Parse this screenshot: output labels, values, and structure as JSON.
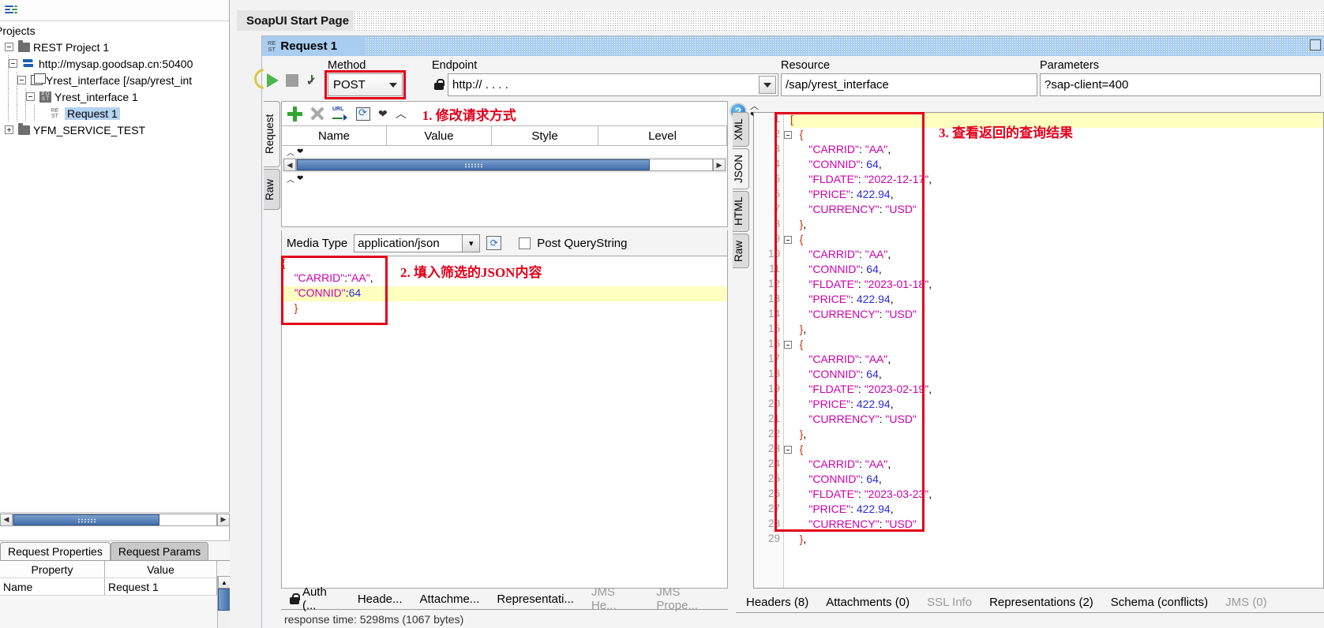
{
  "navigator": {
    "toolbar_icon": "list-green-blue-icon",
    "root_label": "Projects",
    "tree": [
      {
        "label": "REST Project 1",
        "icon": "folder-icon",
        "depth": 0,
        "expander": "minus",
        "selected": false
      },
      {
        "label": "http://mysap.goodsap.cn:50400",
        "icon": "endpoint-arrows-icon",
        "depth": 1,
        "expander": "minus",
        "selected": false
      },
      {
        "label": "Yrest_interface [/sap/yrest_int",
        "icon": "resource-window-icon",
        "depth": 2,
        "expander": "minus",
        "selected": false
      },
      {
        "label": "Yrest_interface 1",
        "icon": "post-method-icon",
        "depth": 3,
        "expander": "minus",
        "selected": false
      },
      {
        "label": "Request 1",
        "icon": "rest-request-icon",
        "depth": 4,
        "expander": "none",
        "selected": true
      },
      {
        "label": "YFM_SERVICE_TEST",
        "icon": "folder-icon",
        "depth": 0,
        "expander": "plus",
        "selected": false
      }
    ],
    "bottom_tabs": [
      {
        "label": "Request Properties",
        "active": true
      },
      {
        "label": "Request Params",
        "active": false
      }
    ],
    "properties_table": {
      "headers": [
        "Property",
        "Value"
      ],
      "rows": [
        [
          "Name",
          "Request 1"
        ]
      ]
    }
  },
  "workspace": {
    "start_page_tab": "SoapUI Start Page",
    "request_window": {
      "title": "Request 1",
      "badge": "RE ST"
    },
    "labels": {
      "method": "Method",
      "endpoint": "Endpoint",
      "resource": "Resource",
      "parameters": "Parameters"
    },
    "method_value": "POST",
    "endpoint_value": "http://    .     .  .        .",
    "resource_value": "/sap/yrest_interface",
    "parameters_value": "?sap-client=400"
  },
  "request_panel": {
    "side_tabs": [
      {
        "label": "Request",
        "active": true
      },
      {
        "label": "Raw",
        "active": false
      }
    ],
    "toolbar_icons": [
      "add-param-icon",
      "remove-param-icon",
      "url-extract-icon",
      "refresh-params-icon",
      "move-down-icon",
      "move-up-icon"
    ],
    "params_headers": [
      "Name",
      "Value",
      "Style",
      "Level"
    ],
    "media_type_label": "Media Type",
    "media_type_value": "application/json",
    "post_querystring_label": "Post QueryString",
    "post_querystring_checked": false,
    "body_lines": [
      {
        "text": "{",
        "highlight": false
      },
      {
        "text": "    \"CARRID\":\"AA\",",
        "highlight": false
      },
      {
        "text": "    \"CONNID\":64",
        "highlight": true
      },
      {
        "text": "    }",
        "highlight": false
      }
    ],
    "bottom_tabs": [
      {
        "label": "Auth (...",
        "icon": "lock-icon",
        "dim": false
      },
      {
        "label": "Heade...",
        "icon": "",
        "dim": false
      },
      {
        "label": "Attachme...",
        "icon": "",
        "dim": false
      },
      {
        "label": "Representati...",
        "icon": "",
        "dim": false
      },
      {
        "label": "JMS He...",
        "icon": "",
        "dim": true
      },
      {
        "label": "JMS Prope...",
        "icon": "",
        "dim": true
      }
    ],
    "status": "response time: 5298ms (1067 bytes)"
  },
  "response_panel": {
    "help_icon": "help-question-icon",
    "side_tabs": [
      {
        "label": "XML",
        "active": false
      },
      {
        "label": "JSON",
        "active": true
      },
      {
        "label": "HTML",
        "active": false
      },
      {
        "label": "Raw",
        "active": false
      }
    ],
    "lines": [
      {
        "n": 1,
        "text": "[",
        "fold": false,
        "highlight": true
      },
      {
        "n": 2,
        "text": "   {",
        "fold": true,
        "highlight": false
      },
      {
        "n": 3,
        "text": "      \"CARRID\": \"AA\",",
        "fold": false,
        "highlight": false
      },
      {
        "n": 4,
        "text": "      \"CONNID\": 64,",
        "fold": false,
        "highlight": false
      },
      {
        "n": 5,
        "text": "      \"FLDATE\": \"2022-12-17\",",
        "fold": false,
        "highlight": false
      },
      {
        "n": 6,
        "text": "      \"PRICE\": 422.94,",
        "fold": false,
        "highlight": false
      },
      {
        "n": 7,
        "text": "      \"CURRENCY\": \"USD\"",
        "fold": false,
        "highlight": false
      },
      {
        "n": 8,
        "text": "   },",
        "fold": false,
        "highlight": false
      },
      {
        "n": 9,
        "text": "   {",
        "fold": true,
        "highlight": false
      },
      {
        "n": 10,
        "text": "      \"CARRID\": \"AA\",",
        "fold": false,
        "highlight": false
      },
      {
        "n": 11,
        "text": "      \"CONNID\": 64,",
        "fold": false,
        "highlight": false
      },
      {
        "n": 12,
        "text": "      \"FLDATE\": \"2023-01-18\",",
        "fold": false,
        "highlight": false
      },
      {
        "n": 13,
        "text": "      \"PRICE\": 422.94,",
        "fold": false,
        "highlight": false
      },
      {
        "n": 14,
        "text": "      \"CURRENCY\": \"USD\"",
        "fold": false,
        "highlight": false
      },
      {
        "n": 15,
        "text": "   },",
        "fold": false,
        "highlight": false
      },
      {
        "n": 16,
        "text": "   {",
        "fold": true,
        "highlight": false
      },
      {
        "n": 17,
        "text": "      \"CARRID\": \"AA\",",
        "fold": false,
        "highlight": false
      },
      {
        "n": 18,
        "text": "      \"CONNID\": 64,",
        "fold": false,
        "highlight": false
      },
      {
        "n": 19,
        "text": "      \"FLDATE\": \"2023-02-19\",",
        "fold": false,
        "highlight": false
      },
      {
        "n": 20,
        "text": "      \"PRICE\": 422.94,",
        "fold": false,
        "highlight": false
      },
      {
        "n": 21,
        "text": "      \"CURRENCY\": \"USD\"",
        "fold": false,
        "highlight": false
      },
      {
        "n": 22,
        "text": "   },",
        "fold": false,
        "highlight": false
      },
      {
        "n": 23,
        "text": "   {",
        "fold": true,
        "highlight": false
      },
      {
        "n": 24,
        "text": "      \"CARRID\": \"AA\",",
        "fold": false,
        "highlight": false
      },
      {
        "n": 25,
        "text": "      \"CONNID\": 64,",
        "fold": false,
        "highlight": false
      },
      {
        "n": 26,
        "text": "      \"FLDATE\": \"2023-03-23\",",
        "fold": false,
        "highlight": false
      },
      {
        "n": 27,
        "text": "      \"PRICE\": 422.94,",
        "fold": false,
        "highlight": false
      },
      {
        "n": 28,
        "text": "      \"CURRENCY\": \"USD\"",
        "fold": false,
        "highlight": false
      },
      {
        "n": 29,
        "text": "   },",
        "fold": false,
        "highlight": false
      }
    ],
    "bottom_tabs": [
      {
        "label": "Headers (8)",
        "dim": false
      },
      {
        "label": "Attachments (0)",
        "dim": false
      },
      {
        "label": "SSL Info",
        "dim": true
      },
      {
        "label": "Representations (2)",
        "dim": false
      },
      {
        "label": "Schema (conflicts)",
        "dim": false
      },
      {
        "label": "JMS (0)",
        "dim": true
      }
    ]
  },
  "annotations": {
    "note1": "1. 修改请求方式",
    "note2": "2. 填入筛选的JSON内容",
    "note3": "3. 查看返回的查询结果",
    "highlight_color": "#e2001a"
  }
}
